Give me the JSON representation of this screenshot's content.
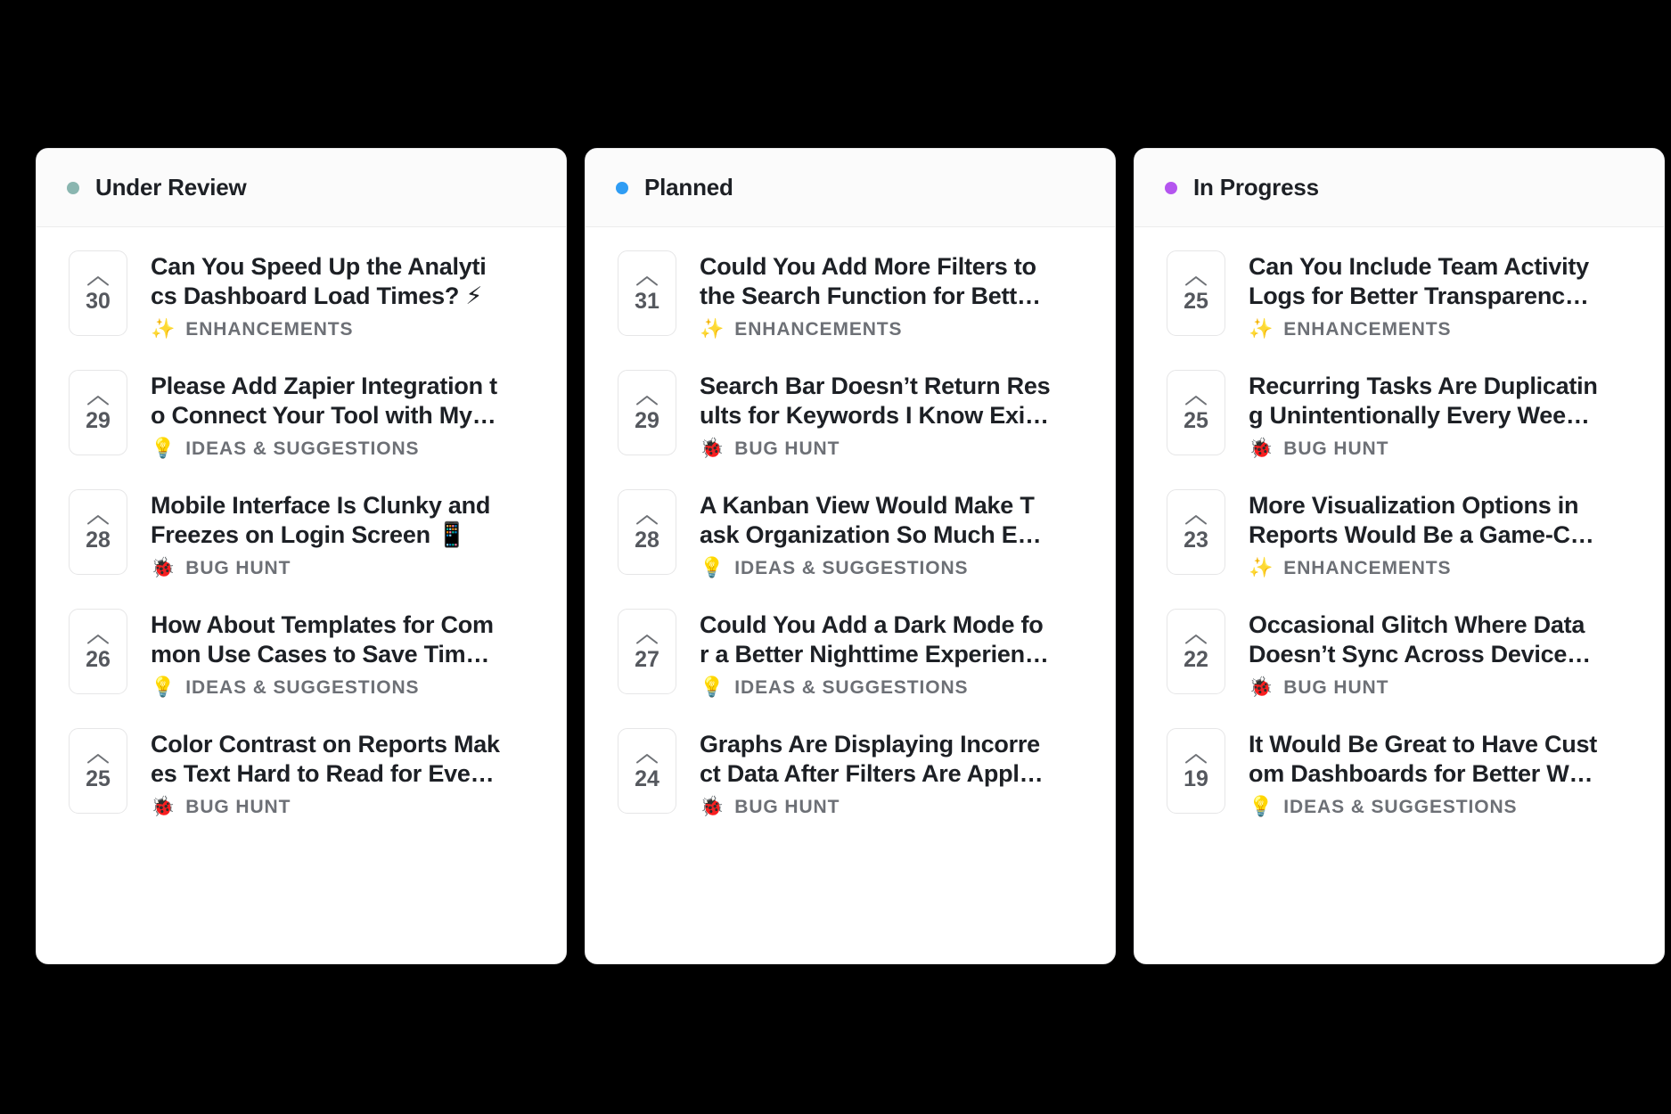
{
  "board": {
    "columns": [
      {
        "id": "under-review",
        "title": "Under Review",
        "dot_color": "#8ab6b0",
        "cards": [
          {
            "votes": "30",
            "title_line1": "Can You Speed Up the Analyti",
            "title_line2": "cs Dashboard Load Times? ⚡",
            "tag_emoji": "✨",
            "tag_label": "ENHANCEMENTS"
          },
          {
            "votes": "29",
            "title_line1": "Please Add Zapier Integration t",
            "title_line2": "o Connect Your Tool with My…",
            "tag_emoji": "💡",
            "tag_label": "IDEAS & SUGGESTIONS"
          },
          {
            "votes": "28",
            "title_line1": "Mobile Interface Is Clunky and",
            "title_line2": "Freezes on Login Screen 📱",
            "tag_emoji": "🐞",
            "tag_label": "BUG HUNT"
          },
          {
            "votes": "26",
            "title_line1": "How About Templates for Com",
            "title_line2": "mon Use Cases to Save Tim…",
            "tag_emoji": "💡",
            "tag_label": "IDEAS & SUGGESTIONS"
          },
          {
            "votes": "25",
            "title_line1": "Color Contrast on Reports Mak",
            "title_line2": "es Text Hard to Read for Eve…",
            "tag_emoji": "🐞",
            "tag_label": "BUG HUNT"
          }
        ]
      },
      {
        "id": "planned",
        "title": "Planned",
        "dot_color": "#2f9df4",
        "cards": [
          {
            "votes": "31",
            "title_line1": "Could You Add More Filters to",
            "title_line2": "the Search Function for Bett…",
            "tag_emoji": "✨",
            "tag_label": "ENHANCEMENTS"
          },
          {
            "votes": "29",
            "title_line1": "Search Bar Doesn’t Return Res",
            "title_line2": "ults for Keywords I Know Exi…",
            "tag_emoji": "🐞",
            "tag_label": "BUG HUNT"
          },
          {
            "votes": "28",
            "title_line1": "A Kanban View Would Make T",
            "title_line2": "ask Organization So Much E…",
            "tag_emoji": "💡",
            "tag_label": "IDEAS & SUGGESTIONS"
          },
          {
            "votes": "27",
            "title_line1": "Could You Add a Dark Mode fo",
            "title_line2": "r a Better Nighttime Experien…",
            "tag_emoji": "💡",
            "tag_label": "IDEAS & SUGGESTIONS"
          },
          {
            "votes": "24",
            "title_line1": "Graphs Are Displaying Incorre",
            "title_line2": "ct Data After Filters Are Appl…",
            "tag_emoji": "🐞",
            "tag_label": "BUG HUNT"
          }
        ]
      },
      {
        "id": "in-progress",
        "title": "In Progress",
        "dot_color": "#b455ef",
        "cards": [
          {
            "votes": "25",
            "title_line1": "Can You Include Team Activity",
            "title_line2": "Logs for Better Transparenc…",
            "tag_emoji": "✨",
            "tag_label": "ENHANCEMENTS"
          },
          {
            "votes": "25",
            "title_line1": "Recurring Tasks Are Duplicatin",
            "title_line2": "g Unintentionally Every Wee…",
            "tag_emoji": "🐞",
            "tag_label": "BUG HUNT"
          },
          {
            "votes": "23",
            "title_line1": "More Visualization Options in",
            "title_line2": "Reports Would Be a Game-C…",
            "tag_emoji": "✨",
            "tag_label": "ENHANCEMENTS"
          },
          {
            "votes": "22",
            "title_line1": "Occasional Glitch Where Data",
            "title_line2": "Doesn’t Sync Across Device…",
            "tag_emoji": "🐞",
            "tag_label": "BUG HUNT"
          },
          {
            "votes": "19",
            "title_line1": "It Would Be Great to Have Cust",
            "title_line2": "om Dashboards for Better W…",
            "tag_emoji": "💡",
            "tag_label": "IDEAS & SUGGESTIONS"
          }
        ]
      }
    ]
  }
}
